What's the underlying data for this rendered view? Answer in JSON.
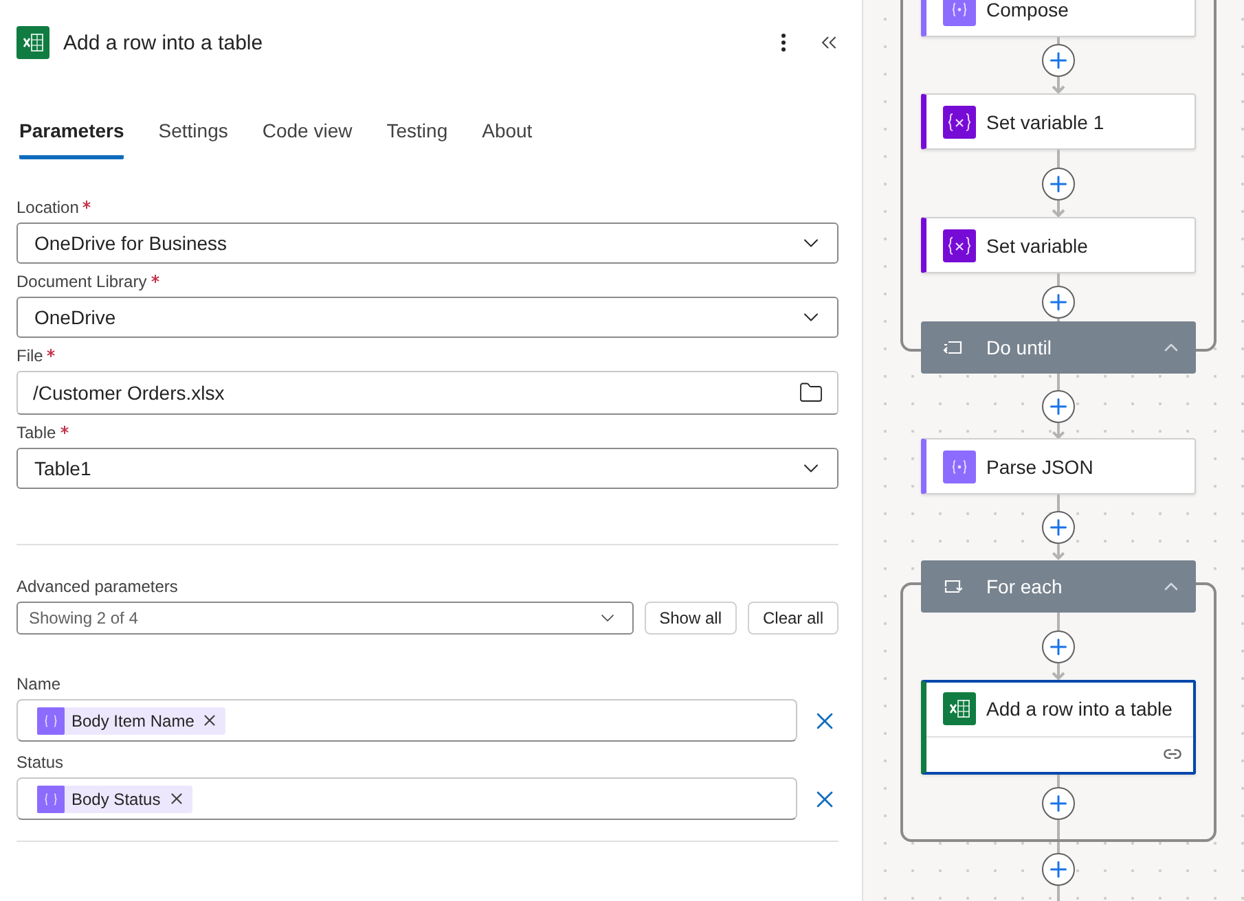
{
  "panel": {
    "title": "Add a row into a table",
    "tabs": [
      {
        "label": "Parameters",
        "selected": true
      },
      {
        "label": "Settings",
        "selected": false
      },
      {
        "label": "Code view",
        "selected": false
      },
      {
        "label": "Testing",
        "selected": false
      },
      {
        "label": "About",
        "selected": false
      }
    ],
    "fields": [
      {
        "label": "Location",
        "required": true,
        "kind": "dropdown",
        "value": "OneDrive for Business"
      },
      {
        "label": "Document Library",
        "required": true,
        "kind": "dropdown",
        "value": "OneDrive"
      },
      {
        "label": "File",
        "required": true,
        "kind": "file",
        "value": "/Customer Orders.xlsx"
      },
      {
        "label": "Table",
        "required": true,
        "kind": "dropdown",
        "value": "Table1"
      }
    ],
    "advanced": {
      "label": "Advanced parameters",
      "value": "Showing 2 of 4",
      "buttons": [
        "Show all",
        "Clear all"
      ]
    },
    "params": [
      {
        "label": "Name",
        "token": "Body Item Name"
      },
      {
        "label": "Status",
        "token": "Body Status"
      }
    ]
  },
  "flow": {
    "items": [
      {
        "kind": "scope",
        "children": [
          {
            "kind": "compose",
            "title": "Compose",
            "color": "#8c6cff",
            "selected": false
          },
          {
            "kind": "variable",
            "title": "Set variable 1",
            "color": "#770bd6",
            "selected": false
          },
          {
            "kind": "variable",
            "title": "Set variable",
            "color": "#770bd6",
            "selected": false
          }
        ]
      },
      {
        "kind": "until",
        "title": "Do until",
        "expanded": true
      },
      {
        "kind": "json",
        "title": "Parse JSON",
        "color": "#8c6cff",
        "selected": false
      },
      {
        "kind": "each",
        "title": "For each",
        "expanded": true,
        "children": [
          {
            "kind": "excel",
            "title": "Add a row into a table",
            "color": "#107c41",
            "selected": true
          }
        ]
      }
    ]
  }
}
